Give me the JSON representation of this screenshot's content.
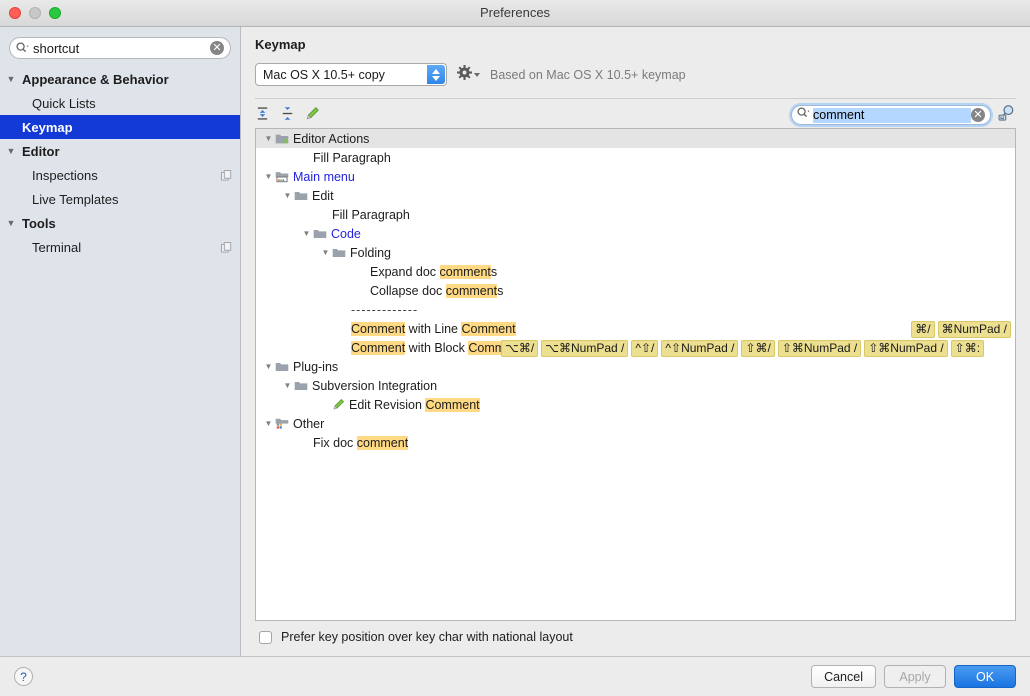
{
  "window": {
    "title": "Preferences",
    "controls": [
      "close",
      "minimize",
      "zoom"
    ]
  },
  "sidebar": {
    "search": {
      "value": "shortcut",
      "placeholder": "",
      "clear_label": "✕"
    },
    "items": [
      {
        "label": "Appearance & Behavior",
        "type": "group",
        "expanded": true,
        "selected": false,
        "copy_badge": false
      },
      {
        "label": "Quick Lists",
        "type": "leaf",
        "expanded": false,
        "selected": false,
        "copy_badge": false
      },
      {
        "label": "Keymap",
        "type": "group",
        "expanded": false,
        "selected": true,
        "copy_badge": false
      },
      {
        "label": "Editor",
        "type": "group",
        "expanded": true,
        "selected": false,
        "copy_badge": false
      },
      {
        "label": "Inspections",
        "type": "leaf",
        "expanded": false,
        "selected": false,
        "copy_badge": true
      },
      {
        "label": "Live Templates",
        "type": "leaf",
        "expanded": false,
        "selected": false,
        "copy_badge": false
      },
      {
        "label": "Tools",
        "type": "group",
        "expanded": true,
        "selected": false,
        "copy_badge": false
      },
      {
        "label": "Terminal",
        "type": "leaf",
        "expanded": false,
        "selected": false,
        "copy_badge": true
      }
    ]
  },
  "pane": {
    "title": "Keymap",
    "keymap_select": {
      "value": "Mac OS X 10.5+ copy"
    },
    "based_on": "Based on Mac OS X 10.5+ keymap",
    "toolbar": {
      "expand_all": "Expand All",
      "collapse_all": "Collapse All",
      "edit_shortcut": "Edit Shortcut"
    },
    "tree_search": {
      "value": "comment",
      "placeholder": "",
      "clear_label": "✕"
    },
    "find_by_shortcut": "Find Actions by Shortcut"
  },
  "tree": [
    {
      "depth": 0,
      "label": "Editor Actions",
      "icon": "editor-actions-icon",
      "twisty": "expanded",
      "header": true,
      "blue": false,
      "highlight": [],
      "shortcuts": []
    },
    {
      "depth": 2,
      "label": "Fill Paragraph",
      "icon": "none",
      "twisty": "none",
      "header": false,
      "blue": false,
      "highlight": [],
      "shortcuts": []
    },
    {
      "depth": 0,
      "label": "Main menu",
      "icon": "main-menu-icon",
      "twisty": "expanded",
      "header": false,
      "blue": true,
      "highlight": [],
      "shortcuts": []
    },
    {
      "depth": 1,
      "label": "Edit",
      "icon": "folder-icon",
      "twisty": "expanded",
      "header": false,
      "blue": false,
      "highlight": [],
      "shortcuts": []
    },
    {
      "depth": 3,
      "label": "Fill Paragraph",
      "icon": "none",
      "twisty": "none",
      "header": false,
      "blue": false,
      "highlight": [],
      "shortcuts": []
    },
    {
      "depth": 2,
      "label": "Code",
      "icon": "folder-icon",
      "twisty": "expanded",
      "header": false,
      "blue": true,
      "highlight": [],
      "shortcuts": []
    },
    {
      "depth": 3,
      "label": "Folding",
      "icon": "folder-icon",
      "twisty": "expanded",
      "header": false,
      "blue": false,
      "highlight": [],
      "shortcuts": []
    },
    {
      "depth": 5,
      "label": "Expand doc comments",
      "icon": "none",
      "twisty": "none",
      "header": false,
      "blue": false,
      "highlight": [
        "comment"
      ],
      "shortcuts": []
    },
    {
      "depth": 5,
      "label": "Collapse doc comments",
      "icon": "none",
      "twisty": "none",
      "header": false,
      "blue": false,
      "highlight": [
        "comment"
      ],
      "shortcuts": []
    },
    {
      "depth": 4,
      "label": "-------------",
      "icon": "none",
      "twisty": "none",
      "header": false,
      "blue": false,
      "separator": true,
      "highlight": [],
      "shortcuts": []
    },
    {
      "depth": 4,
      "label": "Comment with Line Comment",
      "icon": "none",
      "twisty": "none",
      "header": false,
      "blue": false,
      "highlight": [
        "Comment"
      ],
      "shortcuts": [
        "⌘/",
        "⌘NumPad /"
      ],
      "shortcuts_align": "right"
    },
    {
      "depth": 4,
      "label": "Comment with Block Comment",
      "icon": "none",
      "twisty": "none",
      "header": false,
      "blue": false,
      "highlight": [
        "Comment"
      ],
      "shortcuts": [
        "⌥⌘/",
        "⌥⌘NumPad /",
        "^⇧/",
        "^⇧NumPad /",
        "⇧⌘/",
        "⇧⌘NumPad /",
        "⇧⌘NumPad /",
        "⇧⌘:"
      ],
      "shortcuts_align": "inline"
    },
    {
      "depth": 0,
      "label": "Plug-ins",
      "icon": "folder-icon",
      "twisty": "expanded",
      "header": false,
      "blue": false,
      "highlight": [],
      "shortcuts": []
    },
    {
      "depth": 1,
      "label": "Subversion Integration",
      "icon": "folder-icon",
      "twisty": "expanded",
      "header": false,
      "blue": false,
      "highlight": [],
      "shortcuts": []
    },
    {
      "depth": 3,
      "label": "Edit Revision Comment",
      "icon": "pencil-icon",
      "twisty": "none",
      "header": false,
      "blue": false,
      "highlight": [
        "Comment"
      ],
      "shortcuts": []
    },
    {
      "depth": 0,
      "label": "Other",
      "icon": "other-icon",
      "twisty": "expanded",
      "header": false,
      "blue": false,
      "highlight": [],
      "shortcuts": []
    },
    {
      "depth": 2,
      "label": "Fix doc comment",
      "icon": "none",
      "twisty": "none",
      "header": false,
      "blue": false,
      "highlight": [
        "comment"
      ],
      "shortcuts": []
    }
  ],
  "options": {
    "prefer_key_position": {
      "label": "Prefer key position over key char with national layout",
      "checked": false
    }
  },
  "footer": {
    "help": "?",
    "cancel": "Cancel",
    "apply": "Apply",
    "ok": "OK",
    "apply_enabled": false
  },
  "colors": {
    "selection": "#1339d6",
    "highlight": "#ffd983",
    "shortcut_badge": "#ecdf8f",
    "link": "#2222dd",
    "primary_button": "#1a74e2",
    "sidebar_bg": "#dfe3ea"
  }
}
